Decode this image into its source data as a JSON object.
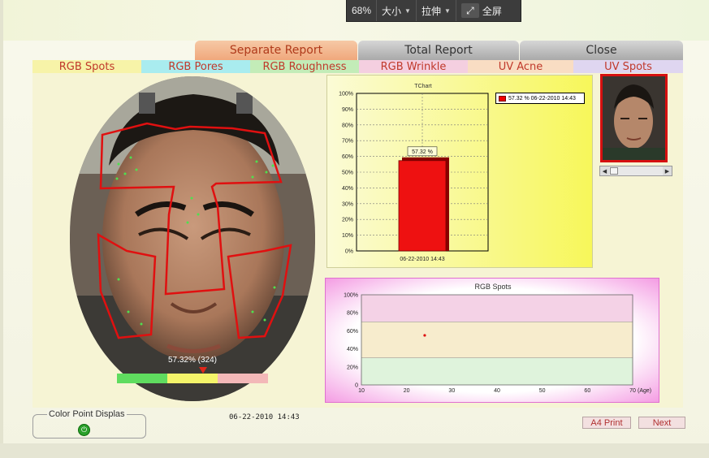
{
  "player": {
    "zoom": "68%",
    "size_label": "大小",
    "stretch_label": "拉伸",
    "fullscreen_label": "全屏"
  },
  "report_tabs": {
    "separate": "Separate Report",
    "total": "Total Report",
    "close": "Close"
  },
  "sub_tabs": [
    "RGB Spots",
    "RGB Pores",
    "RGB Roughness",
    "RGB Wrinkle",
    "UV Acne",
    "UV Spots"
  ],
  "face": {
    "score_text": "57.32% (324)",
    "scale_colors": [
      "#5fdc5f",
      "#f4f46a",
      "#f3b8b8"
    ],
    "scale_marker_fraction": 0.57
  },
  "bar_chart": {
    "title": "TChart",
    "legend": "57.32 % 06-22-2010 14:43",
    "bar_label": "57.32 %"
  },
  "age_chart": {
    "title": "RGB Spots",
    "xlabel": "(Age)"
  },
  "chart_data": [
    {
      "type": "bar",
      "title": "TChart",
      "categories": [
        "06-22-2010 14:43"
      ],
      "values": [
        57.32
      ],
      "ylim": [
        0,
        100
      ],
      "yticks": [
        "0%",
        "10%",
        "20%",
        "30%",
        "40%",
        "50%",
        "60%",
        "70%",
        "80%",
        "90%",
        "100%"
      ],
      "color": "#ee1111",
      "grid": true,
      "legend": "top-right"
    },
    {
      "type": "scatter",
      "title": "RGB Spots",
      "x": [
        24
      ],
      "y": [
        55
      ],
      "xlim": [
        10,
        70
      ],
      "ylim": [
        0,
        100
      ],
      "xticks": [
        "10",
        "20",
        "30",
        "40",
        "50",
        "60",
        "70"
      ],
      "yticks": [
        "0",
        "20%",
        "40%",
        "60%",
        "80%",
        "100%"
      ],
      "xlabel": "(Age)",
      "bands": [
        {
          "from": 70,
          "to": 100,
          "color": "#f4d2e6"
        },
        {
          "from": 30,
          "to": 70,
          "color": "#f7eccd"
        },
        {
          "from": 0,
          "to": 30,
          "color": "#dff3dc"
        }
      ],
      "point_color": "#dd1111"
    }
  ],
  "bottom": {
    "color_point_label": "Color Point Displas",
    "timestamp": "06-22-2010 14:43",
    "a4_print": "A4 Print",
    "next": "Next"
  }
}
